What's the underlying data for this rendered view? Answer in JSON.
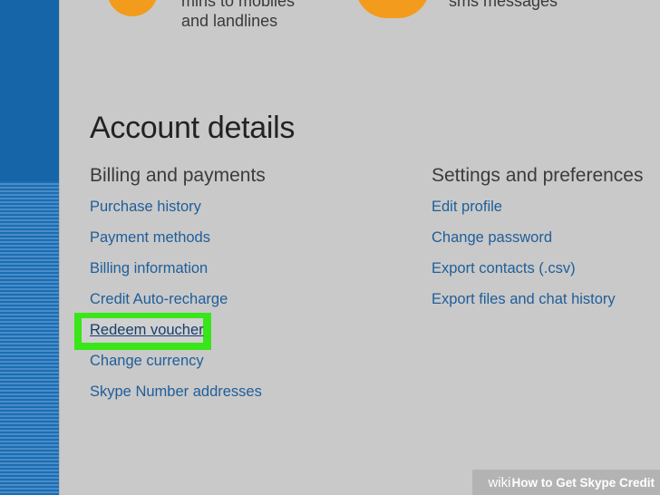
{
  "top": {
    "left_text_line1": "mins to mobiles",
    "left_text_line2": "and landlines",
    "right_text": "sms messages"
  },
  "title": "Account details",
  "billing": {
    "heading": "Billing and payments",
    "links": [
      "Purchase history",
      "Payment methods",
      "Billing information",
      "Credit Auto-recharge",
      "Redeem voucher",
      "Change currency",
      "Skype Number addresses"
    ]
  },
  "settings": {
    "heading": "Settings and preferences",
    "links": [
      "Edit profile",
      "Change password",
      "Export contacts (.csv)",
      "Export files and chat history"
    ]
  },
  "watermark": {
    "brand": "wiki",
    "text": "How to Get Skype Credit"
  },
  "colors": {
    "highlight": "#39e619",
    "link": "#1f5e9a",
    "sidebar": "#1565a8"
  }
}
